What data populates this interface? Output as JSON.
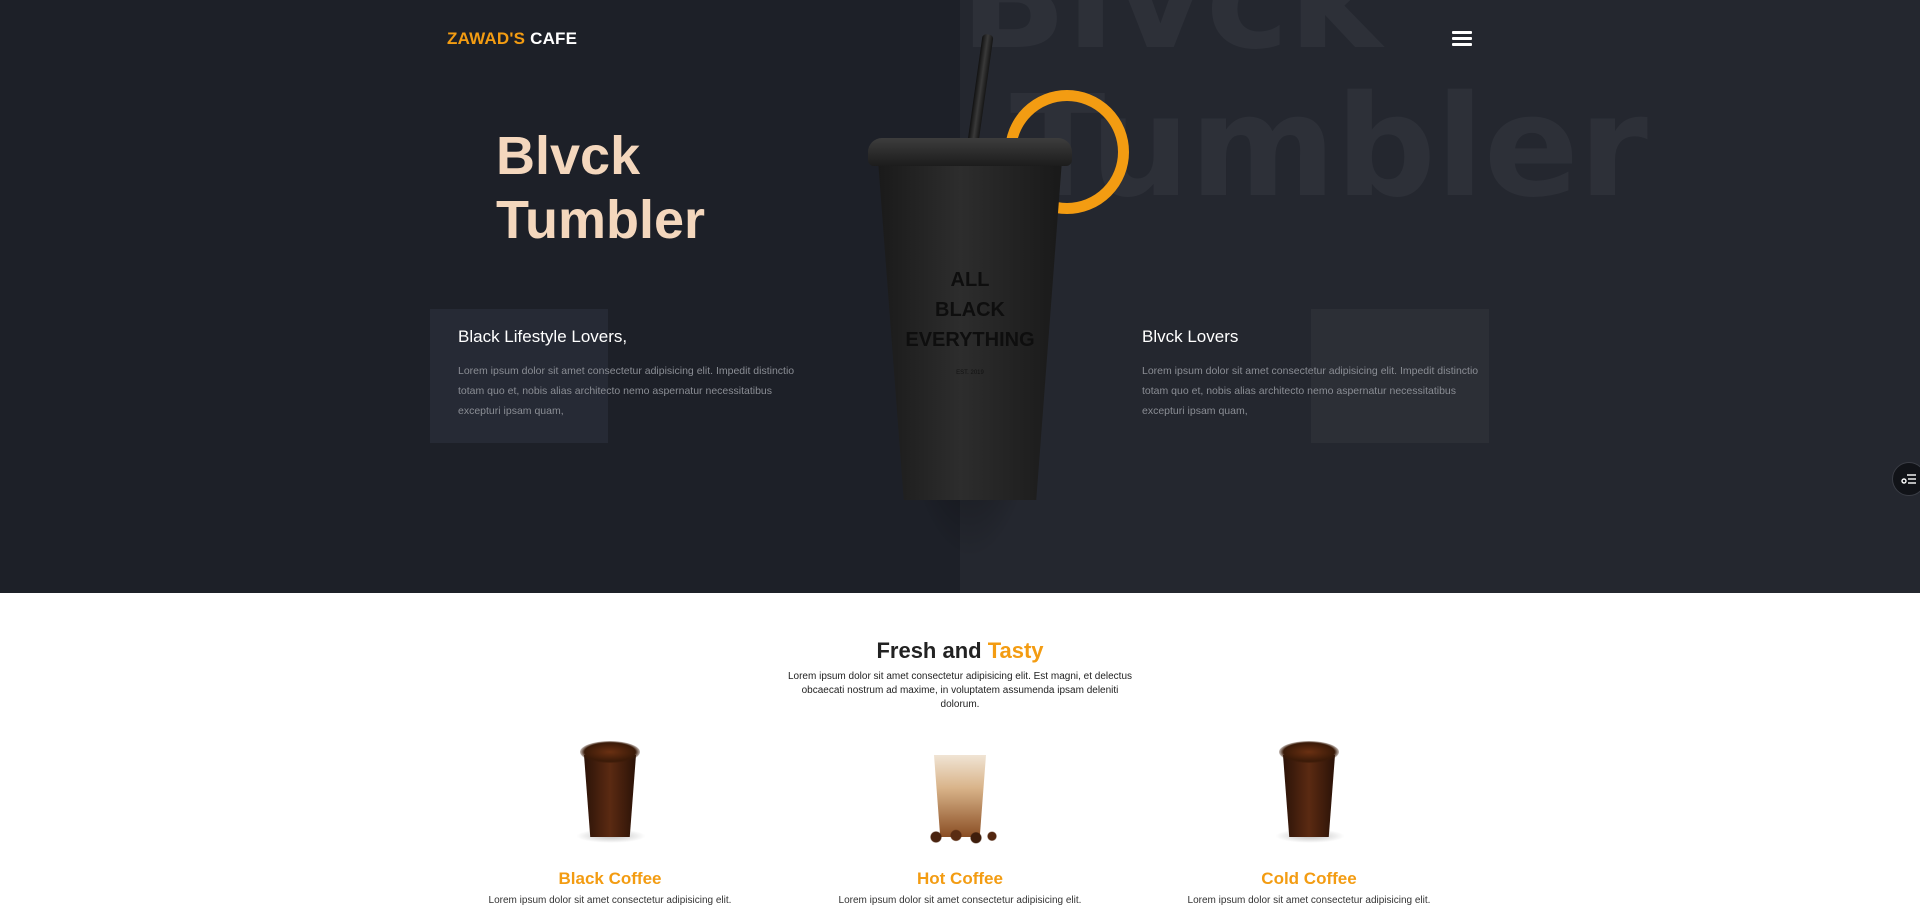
{
  "brand": {
    "accent": "ZAWAD'S",
    "rest": " CAFE"
  },
  "menu_icon": "hamburger-menu-icon",
  "hero": {
    "bg_word_1": "Blvck",
    "bg_word_2": "Tumbler",
    "title_line_1": "Blvck",
    "title_line_2": "Tumbler",
    "cup_text_1": "ALL",
    "cup_text_2": "BLACK",
    "cup_text_3": "EVERYTHING",
    "cup_small": "EST. 2019"
  },
  "info_left": {
    "heading": "Black Lifestyle Lovers,",
    "body": "Lorem ipsum dolor sit amet consectetur adipisicing elit. Impedit distinctio totam quo et, nobis alias architecto nemo aspernatur necessitatibus excepturi ipsam quam,"
  },
  "info_right": {
    "heading": "Blvck Lovers",
    "body": "Lorem ipsum dolor sit amet consectetur adipisicing elit. Impedit distinctio totam quo et, nobis alias architecto nemo aspernatur necessitatibus excepturi ipsam quam,"
  },
  "section": {
    "title_part_1": "Fresh and ",
    "title_part_2": "Tasty",
    "desc": "Lorem ipsum dolor sit amet consectetur adipisicing elit. Est magni, et delectus obcaecati nostrum ad maxime, in voluptatem assumenda ipsam deleniti dolorum."
  },
  "products": [
    {
      "name": "Black Coffee",
      "text": "Lorem ipsum dolor sit amet consectetur adipisicing elit."
    },
    {
      "name": "Hot Coffee",
      "text": "Lorem ipsum dolor sit amet consectetur adipisicing elit."
    },
    {
      "name": "Cold Coffee",
      "text": "Lorem ipsum dolor sit amet consectetur adipisicing elit."
    }
  ],
  "colors": {
    "accent": "#f39c12",
    "hero_bg": "#1d2028",
    "title": "#f4d7bd"
  }
}
